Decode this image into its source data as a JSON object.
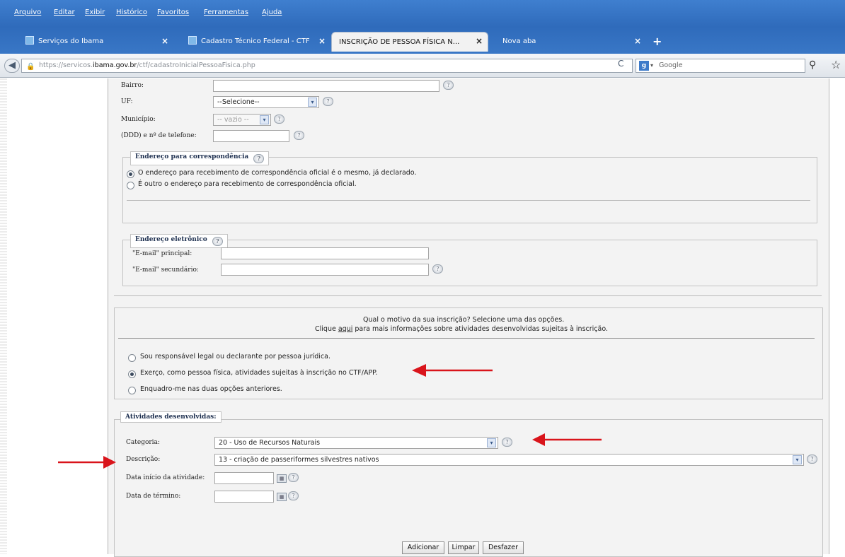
{
  "browser": {
    "menu": [
      "Arquivo",
      "Editar",
      "Exibir",
      "Histórico",
      "Favoritos",
      "Ferramentas",
      "Ajuda"
    ],
    "tabs": [
      {
        "label": "Serviços do Ibama"
      },
      {
        "label": "Cadastro Técnico Federal - CTF"
      },
      {
        "label": "INSCRIÇÃO DE PESSOA FÍSICA N..."
      },
      {
        "label": "Nova aba"
      }
    ],
    "url_prefix": "https://servicos.",
    "url_domain": "ibama.gov.br",
    "url_path": "/ctf/cadastroInicialPessoaFisica.php",
    "search_placeholder": "Google"
  },
  "form": {
    "bairro_label": "Bairro:",
    "uf_label": "UF:",
    "uf_value": "--Selecione--",
    "municipio_label": "Município:",
    "municipio_value": "-- vazio --",
    "telefone_label": "(DDD) e nº de telefone:",
    "correspondencia": {
      "legend": "Endereço para correspondência",
      "options": [
        "O endereço para recebimento de correspondência oficial é o mesmo, já declarado.",
        "É outro o endereço para recebimento de correspondência oficial."
      ]
    },
    "eletronico": {
      "legend": "Endereço eletrônico",
      "email_principal_label": "\"E-mail\" principal:",
      "email_secundario_label": "\"E-mail\" secundário:"
    },
    "motivo": {
      "line1": "Qual o motivo da sua inscrição? Selecione uma das opções.",
      "line2_pre": "Clique ",
      "line2_link": "aqui",
      "line2_post": " para mais informações sobre atividades desenvolvidas sujeitas à inscrição.",
      "options": [
        "Sou responsável legal ou declarante por pessoa jurídica.",
        "Exerço, como pessoa física, atividades sujeitas à inscrição no CTF/APP.",
        "Enquadro-me nas duas opções anteriores."
      ]
    },
    "atividades": {
      "legend": "Atividades desenvolvidas:",
      "categoria_label": "Categoria:",
      "categoria_value": "20 - Uso de Recursos Naturais",
      "descricao_label": "Descrição:",
      "descricao_value": "13 - criação de passeriformes silvestres nativos",
      "data_inicio_label": "Data início da atividade:",
      "data_termino_label": "Data de término:"
    },
    "buttons": {
      "adicionar": "Adicionar",
      "limpar": "Limpar",
      "desfazer": "Desfazer"
    }
  },
  "colors": {
    "annotation_arrow": "#d9141b",
    "chrome_blue": "#2f6bbb"
  }
}
